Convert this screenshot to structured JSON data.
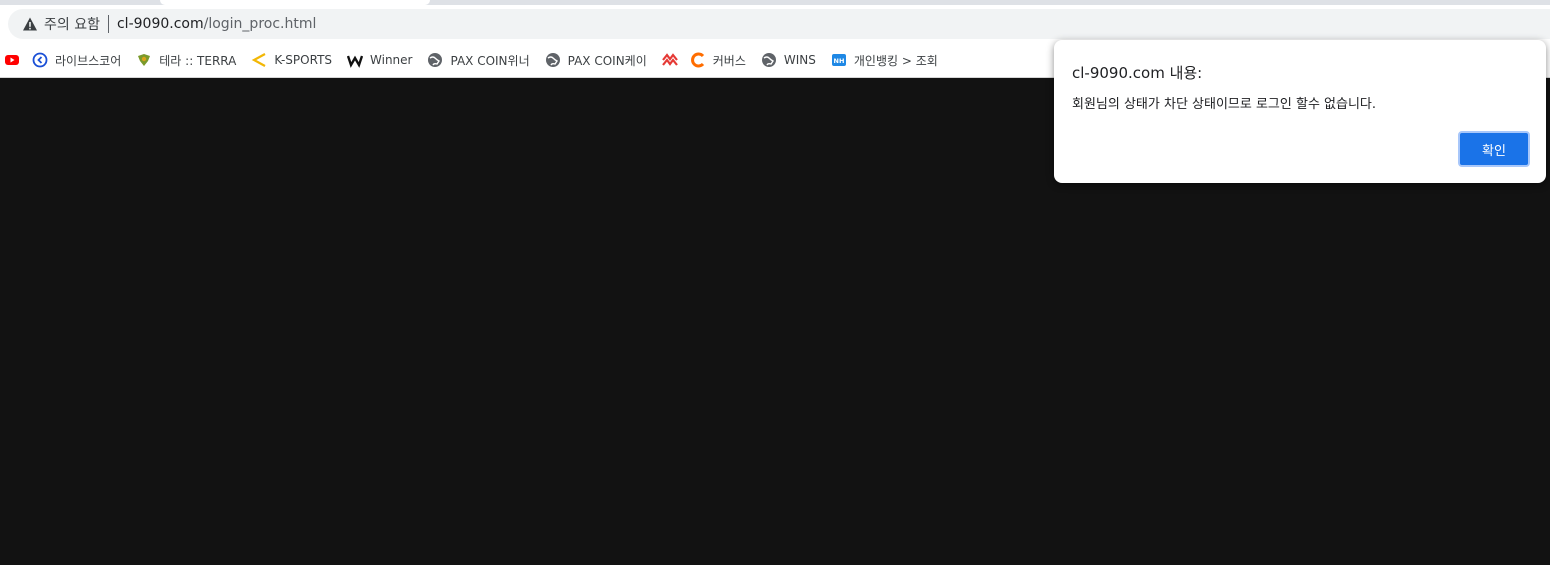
{
  "omnibox": {
    "warning_label": "주의 요함",
    "url_host": "cl-9090.com",
    "url_path": "/login_proc.html"
  },
  "bookmarks": [
    {
      "label": "",
      "icon": "youtube-icon"
    },
    {
      "label": "라이브스코어",
      "icon": "livescore-icon"
    },
    {
      "label": "테라 :: TERRA",
      "icon": "terra-icon"
    },
    {
      "label": "K-SPORTS",
      "icon": "ksports-icon"
    },
    {
      "label": "Winner",
      "icon": "winner-w-icon"
    },
    {
      "label": "PAX COIN위너",
      "icon": "globe-icon"
    },
    {
      "label": "PAX COIN케이",
      "icon": "globe-icon"
    },
    {
      "label": "",
      "icon": "zigzag-icon"
    },
    {
      "label": "커버스",
      "icon": "coverse-icon"
    },
    {
      "label": "WINS",
      "icon": "globe-icon"
    },
    {
      "label": "개인뱅킹 > 조회",
      "icon": "nh-icon"
    }
  ],
  "dialog": {
    "title": "cl-9090.com 내용:",
    "message": "회원님의 상태가 차단 상태이므로 로그인 할수 없습니다.",
    "ok_label": "확인"
  },
  "colors": {
    "page_background": "#121212",
    "primary_button": "#1a73e8"
  }
}
